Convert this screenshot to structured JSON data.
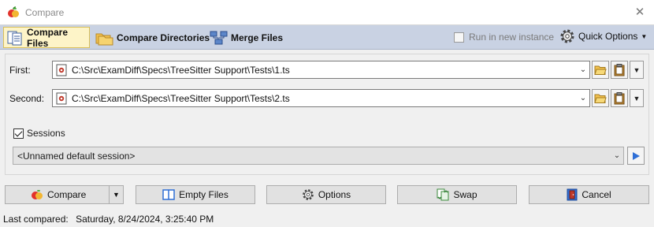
{
  "window": {
    "title": "Compare"
  },
  "toolbar": {
    "compare_files": "Compare Files",
    "compare_directories": "Compare Directories",
    "merge_files": "Merge Files",
    "run_in_new_instance": "Run in new instance",
    "quick_options": "Quick Options"
  },
  "fields": {
    "first_label": "First:",
    "first_path": "C:\\Src\\ExamDiff\\Specs\\TreeSitter Support\\Tests\\1.ts",
    "second_label": "Second:",
    "second_path": "C:\\Src\\ExamDiff\\Specs\\TreeSitter Support\\Tests\\2.ts"
  },
  "sessions": {
    "label": "Sessions",
    "checked": true,
    "selected": "<Unnamed default session>"
  },
  "actions": {
    "compare": "Compare",
    "empty_files": "Empty Files",
    "options": "Options",
    "swap": "Swap",
    "cancel": "Cancel"
  },
  "status": {
    "label": "Last compared:",
    "value": "Saturday, 8/24/2024, 3:25:40 PM"
  },
  "colors": {
    "toolbar_bg": "#c9d2e3",
    "active_tab_bg": "#fdf4c8",
    "folder_yellow": "#f2c14e",
    "accent_blue": "#2f6fd6"
  }
}
